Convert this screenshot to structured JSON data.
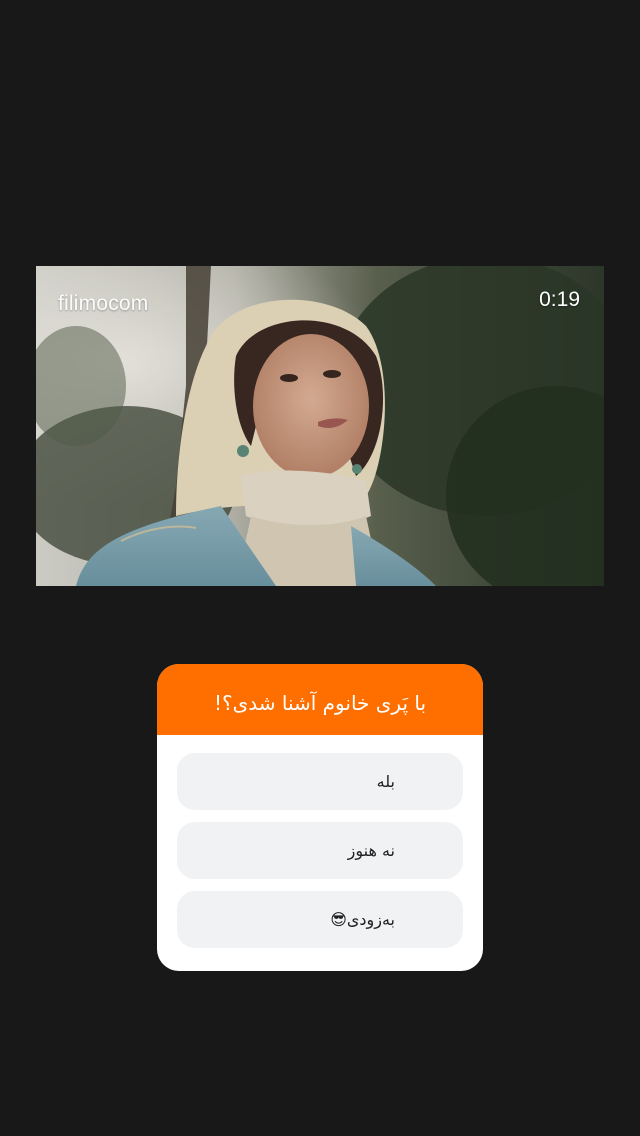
{
  "video": {
    "watermark": "filimocom",
    "timestamp": "0:19"
  },
  "poll": {
    "question": "با پَری خانوم آشنا شدی؟!",
    "accent_color": "#ff6f00",
    "options": [
      {
        "label": "بله"
      },
      {
        "label": "نه هنوز"
      },
      {
        "label": "به‌زودی😎"
      }
    ]
  }
}
